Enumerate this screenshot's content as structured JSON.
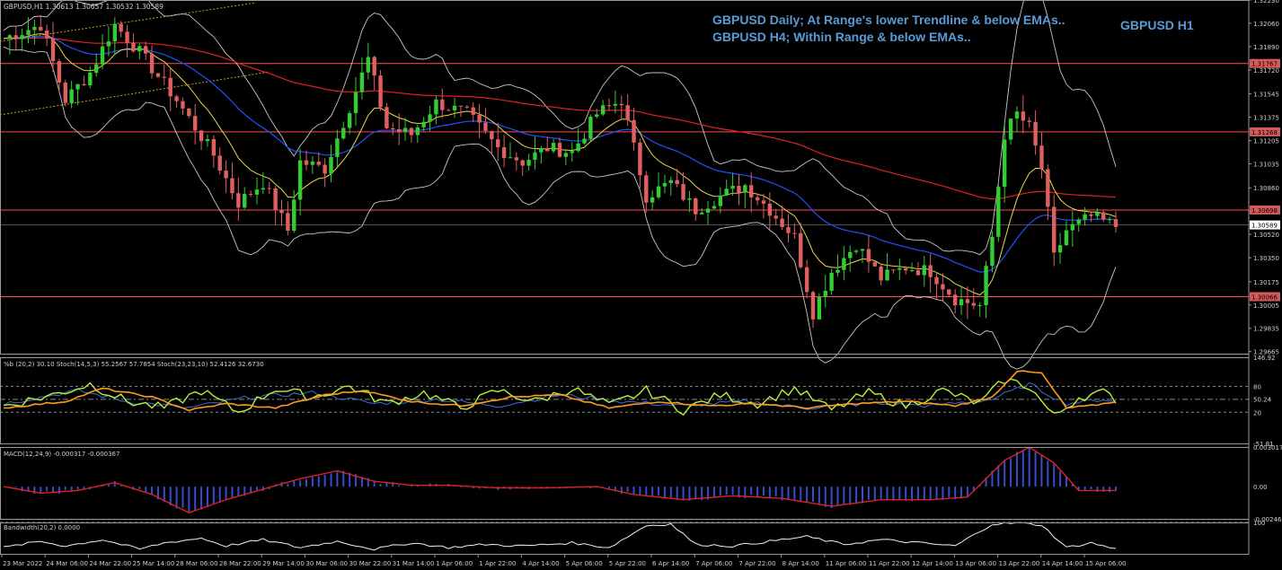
{
  "header": {
    "symbol_line": "GBPUSD,H1  1.30613 1.30657 1.30532 1.30589"
  },
  "annotations": {
    "line1": "GBPUSD Daily; At Range's lower Trendline & below EMAs..",
    "line2": "GBPUSD H4; Within Range & below EMAs..",
    "tf": "GBPUSD H1"
  },
  "colors": {
    "background": "#000000",
    "bull": "#33cc33",
    "bear": "#e06060",
    "hline": "#ff4d4d",
    "ema_long": "#e02020",
    "ema_mid": "#2050ff",
    "ema_short": "#e8d84a",
    "bands": "#c8c8c8",
    "annotation": "#5b9bd5"
  },
  "chart_data": [
    {
      "type": "candlestick",
      "title": "GBPUSD,H1",
      "ylim": [
        1.2965,
        1.3223
      ],
      "y_ticks": [
        "1.32230",
        "1.32060",
        "1.31890",
        "1.31720",
        "1.31545",
        "1.31375",
        "1.31205",
        "1.31035",
        "1.30860",
        "1.30690",
        "1.30520",
        "1.30350",
        "1.30175",
        "1.30005",
        "1.29835",
        "1.29665"
      ],
      "x_ticks": [
        "23 Mar 2022",
        "24 Mar 06:00",
        "24 Mar 22:00",
        "25 Mar 14:00",
        "28 Mar 06:00",
        "28 Mar 22:00",
        "29 Mar 14:00",
        "30 Mar 06:00",
        "30 Mar 22:00",
        "31 Mar 14:00",
        "1 Apr 06:00",
        "1 Apr 22:00",
        "4 Apr 14:00",
        "5 Apr 06:00",
        "5 Apr 22:00",
        "6 Apr 14:00",
        "7 Apr 06:00",
        "7 Apr 22:00",
        "8 Apr 14:00",
        "11 Apr 06:00",
        "11 Apr 22:00",
        "12 Apr 14:00",
        "13 Apr 06:00",
        "13 Apr 22:00",
        "14 Apr 14:00",
        "15 Apr 06:00"
      ],
      "horizontal_levels": [
        {
          "value": 1.31767,
          "label": "1.31767"
        },
        {
          "value": 1.31268,
          "label": "1.31268"
        },
        {
          "value": 1.30698,
          "label": "1.30698"
        },
        {
          "value": 1.30066,
          "label": "1.30066"
        }
      ],
      "current_price": {
        "value": 1.30589,
        "label": "1.30589"
      },
      "close_path": [
        [
          0,
          1.3195
        ],
        [
          6,
          1.3205
        ],
        [
          10,
          1.315
        ],
        [
          14,
          1.317
        ],
        [
          18,
          1.3205
        ],
        [
          22,
          1.3185
        ],
        [
          28,
          1.315
        ],
        [
          34,
          1.311
        ],
        [
          38,
          1.3075
        ],
        [
          42,
          1.309
        ],
        [
          46,
          1.3055
        ],
        [
          48,
          1.3105
        ],
        [
          52,
          1.31
        ],
        [
          56,
          1.3145
        ],
        [
          59,
          1.318
        ],
        [
          62,
          1.313
        ],
        [
          66,
          1.3125
        ],
        [
          70,
          1.3148
        ],
        [
          75,
          1.314
        ],
        [
          80,
          1.3115
        ],
        [
          84,
          1.3105
        ],
        [
          88,
          1.3115
        ],
        [
          92,
          1.3112
        ],
        [
          96,
          1.314
        ],
        [
          100,
          1.315
        ],
        [
          104,
          1.308
        ],
        [
          108,
          1.309
        ],
        [
          112,
          1.307
        ],
        [
          116,
          1.308
        ],
        [
          120,
          1.3088
        ],
        [
          124,
          1.307
        ],
        [
          128,
          1.305
        ],
        [
          131,
          1.2995
        ],
        [
          134,
          1.3025
        ],
        [
          138,
          1.3045
        ],
        [
          142,
          1.302
        ],
        [
          146,
          1.3028
        ],
        [
          150,
          1.3025
        ],
        [
          154,
          1.3005
        ],
        [
          158,
          1.3
        ],
        [
          160,
          1.305
        ],
        [
          162,
          1.3125
        ],
        [
          164,
          1.314
        ],
        [
          166,
          1.313
        ],
        [
          168,
          1.31
        ],
        [
          170,
          1.3035
        ],
        [
          172,
          1.3055
        ],
        [
          176,
          1.3065
        ],
        [
          180,
          1.3058
        ]
      ]
    },
    {
      "type": "line",
      "title": "%b (20,2) 30.10  Stoch(14,5,3) 55.2567 57.7854  Stoch(23,23,10) 52.4126 32.6730",
      "ylim": [
        -51.81,
        146.92
      ],
      "y_ticks": [
        "146.92",
        "80",
        "50.24",
        "20",
        "-51.81"
      ],
      "levels": [
        80,
        50,
        20
      ],
      "stoch_fast": [
        [
          0,
          35
        ],
        [
          8,
          60
        ],
        [
          14,
          85
        ],
        [
          20,
          45
        ],
        [
          26,
          30
        ],
        [
          32,
          70
        ],
        [
          38,
          20
        ],
        [
          44,
          75
        ],
        [
          50,
          55
        ],
        [
          56,
          80
        ],
        [
          62,
          40
        ],
        [
          68,
          65
        ],
        [
          74,
          30
        ],
        [
          80,
          70
        ],
        [
          86,
          45
        ],
        [
          92,
          75
        ],
        [
          98,
          35
        ],
        [
          104,
          70
        ],
        [
          110,
          25
        ],
        [
          116,
          60
        ],
        [
          122,
          40
        ],
        [
          128,
          75
        ],
        [
          134,
          25
        ],
        [
          140,
          65
        ],
        [
          146,
          35
        ],
        [
          152,
          70
        ],
        [
          158,
          40
        ],
        [
          162,
          95
        ],
        [
          166,
          80
        ],
        [
          170,
          10
        ],
        [
          174,
          55
        ],
        [
          178,
          65
        ],
        [
          180,
          50
        ]
      ],
      "stoch_slow": [
        [
          0,
          30
        ],
        [
          10,
          45
        ],
        [
          16,
          75
        ],
        [
          24,
          55
        ],
        [
          30,
          25
        ],
        [
          36,
          40
        ],
        [
          44,
          30
        ],
        [
          52,
          60
        ],
        [
          58,
          70
        ],
        [
          66,
          45
        ],
        [
          74,
          35
        ],
        [
          82,
          55
        ],
        [
          90,
          60
        ],
        [
          98,
          30
        ],
        [
          106,
          45
        ],
        [
          114,
          35
        ],
        [
          122,
          40
        ],
        [
          130,
          30
        ],
        [
          138,
          40
        ],
        [
          146,
          45
        ],
        [
          154,
          35
        ],
        [
          160,
          55
        ],
        [
          164,
          115
        ],
        [
          168,
          110
        ],
        [
          172,
          30
        ],
        [
          176,
          35
        ],
        [
          180,
          45
        ]
      ],
      "pct_b": [
        [
          0,
          40
        ],
        [
          12,
          70
        ],
        [
          20,
          45
        ],
        [
          30,
          30
        ],
        [
          40,
          55
        ],
        [
          50,
          65
        ],
        [
          60,
          40
        ],
        [
          70,
          50
        ],
        [
          80,
          35
        ],
        [
          90,
          60
        ],
        [
          100,
          45
        ],
        [
          110,
          35
        ],
        [
          120,
          45
        ],
        [
          130,
          30
        ],
        [
          140,
          40
        ],
        [
          150,
          35
        ],
        [
          160,
          50
        ],
        [
          166,
          85
        ],
        [
          172,
          40
        ],
        [
          178,
          50
        ],
        [
          180,
          45
        ]
      ]
    },
    {
      "type": "line",
      "title": "MACD(12,24,9) -0.000317 -0.000367",
      "ylim": [
        -0.002461,
        0.003017
      ],
      "y_ticks": [
        "0.003017",
        "0.00",
        "-0.002461"
      ],
      "signal": [
        [
          0,
          0.0
        ],
        [
          6,
          -0.0005
        ],
        [
          12,
          -0.0003
        ],
        [
          18,
          0.0003
        ],
        [
          24,
          -0.0006
        ],
        [
          30,
          -0.002
        ],
        [
          36,
          -0.001
        ],
        [
          42,
          -0.0002
        ],
        [
          48,
          0.0006
        ],
        [
          54,
          0.0012
        ],
        [
          60,
          0.0004
        ],
        [
          66,
          0.0001
        ],
        [
          72,
          0.0001
        ],
        [
          80,
          -0.0001
        ],
        [
          88,
          -0.0001
        ],
        [
          96,
          0.0
        ],
        [
          102,
          -0.0006
        ],
        [
          110,
          -0.001
        ],
        [
          118,
          -0.0007
        ],
        [
          126,
          -0.0009
        ],
        [
          134,
          -0.0015
        ],
        [
          142,
          -0.001
        ],
        [
          150,
          -0.001
        ],
        [
          156,
          -0.0008
        ],
        [
          162,
          0.002
        ],
        [
          166,
          0.003
        ],
        [
          170,
          0.0018
        ],
        [
          174,
          -0.0003
        ],
        [
          180,
          -0.0003
        ]
      ]
    },
    {
      "type": "area",
      "title": "Bandwidth(20,2) 0.0000",
      "ylim": [
        0,
        100
      ],
      "y_ticks": [
        "100"
      ],
      "values": [
        [
          0,
          20
        ],
        [
          6,
          40
        ],
        [
          10,
          25
        ],
        [
          16,
          45
        ],
        [
          22,
          15
        ],
        [
          26,
          35
        ],
        [
          32,
          50
        ],
        [
          36,
          25
        ],
        [
          42,
          45
        ],
        [
          48,
          20
        ],
        [
          54,
          40
        ],
        [
          60,
          15
        ],
        [
          66,
          35
        ],
        [
          72,
          20
        ],
        [
          78,
          30
        ],
        [
          84,
          25
        ],
        [
          92,
          35
        ],
        [
          98,
          20
        ],
        [
          104,
          90
        ],
        [
          108,
          95
        ],
        [
          112,
          30
        ],
        [
          118,
          25
        ],
        [
          124,
          40
        ],
        [
          130,
          55
        ],
        [
          136,
          30
        ],
        [
          142,
          45
        ],
        [
          148,
          35
        ],
        [
          154,
          25
        ],
        [
          160,
          95
        ],
        [
          164,
          98
        ],
        [
          168,
          92
        ],
        [
          172,
          20
        ],
        [
          176,
          35
        ],
        [
          180,
          15
        ]
      ]
    }
  ]
}
